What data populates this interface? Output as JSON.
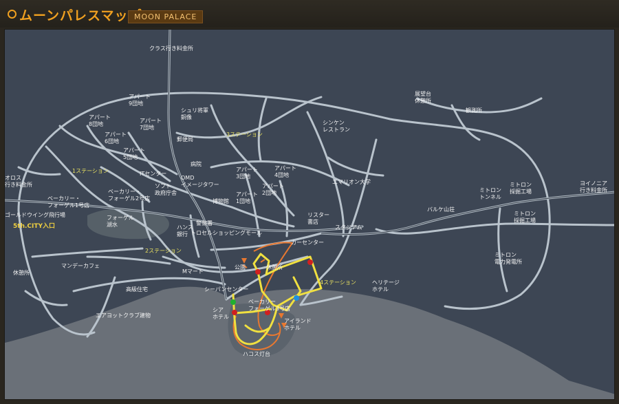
{
  "header": {
    "title": "ムーンパレスマップ",
    "tag": "MOON PALACE"
  },
  "colors": {
    "route": "#f0e040",
    "orange": "#e87830",
    "dot_red": "#d02020",
    "dot_green": "#20b030",
    "dot_blue": "#2090e0"
  },
  "labels": {
    "crass_toll": "クラス行き料金所",
    "apart8": "アパート 8団地",
    "apart7": "アパート 7団地",
    "apart9": "アパート 9団地",
    "apart6": "アパート 6団地",
    "apart5": "アパート 5団地",
    "shuri": "シュリ将軍 銅像",
    "post": "郵便局",
    "station3": "3ステーション",
    "shinken": "シンケン レストラン",
    "tenbou": "展望台 休憩所",
    "kansoku": "観測所",
    "station1": "1ステーション",
    "it_center": "ITセンター",
    "hospital": "病院",
    "apart3": "アパート 3団地",
    "apart4": "アパート 4団地",
    "oros": "オロス 行き料金所",
    "bakery1": "ベーカリー・ フォーゲル1号店",
    "bakery2": "ベーカリー・ フォーゲル2号店",
    "omd": "OMD イメージタワー",
    "soft": "ソフト 政府庁舎",
    "emerion": "エマリオン大学",
    "apart2": "アパート 2団地",
    "apart1": "アパート 1団地",
    "museum": "博物館",
    "mitron_tunnel": "ミトロン トンネル",
    "mitron_site1": "ミトロン 採掘工場",
    "yoinia": "ヨイノニア 行き料金所",
    "baruke": "バルケ山荘",
    "mitron_site2": "ミトロン 採掘工場",
    "gold_wing": "ゴールドウイング飛行場",
    "city_entrance": "5th.CITY入口",
    "vogel_lake": "フォーゲル 湖水",
    "hans_bank": "ハンス 銀行",
    "police": "警察署",
    "ristar": "リスター 書店",
    "stadium": "スタジアム",
    "mall": "トロセルショッピングモール",
    "station2": "2ステーション",
    "car_center": "カーセンター",
    "mitron_power": "ミトロン 電力発電所",
    "monday_cafe": "マンデーカフェ",
    "park": "公園",
    "rest_office": "休憩所",
    "m_mart": "Mマート",
    "station4": "4ステーション",
    "heritage": "ヘリテージ ホテル",
    "rest_left": "休憩所",
    "koukyu": "高級住宅",
    "sea_center": "シーパンセンター",
    "bakery3": "ベーカリー フォーゲル3号店",
    "shua_hotel": "シア ホテル",
    "island": "アイランド ホテル",
    "yacht": "エアヨットクラブ建物",
    "lighthouse": "ハコス灯台"
  }
}
